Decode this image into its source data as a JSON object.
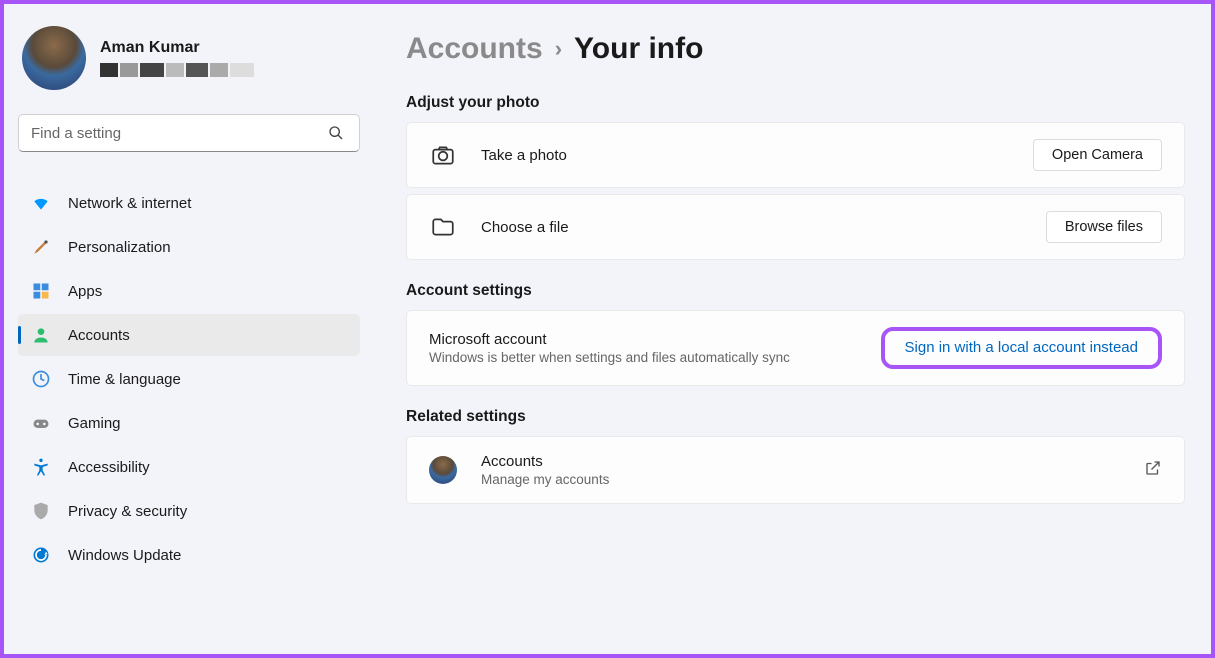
{
  "profile": {
    "name": "Aman Kumar"
  },
  "search": {
    "placeholder": "Find a setting"
  },
  "nav": {
    "network": "Network & internet",
    "personalization": "Personalization",
    "apps": "Apps",
    "accounts": "Accounts",
    "time": "Time & language",
    "gaming": "Gaming",
    "accessibility": "Accessibility",
    "privacy": "Privacy & security",
    "update": "Windows Update"
  },
  "breadcrumb": {
    "parent": "Accounts",
    "current": "Your info"
  },
  "sections": {
    "photo": {
      "title": "Adjust your photo",
      "take": "Take a photo",
      "take_btn": "Open Camera",
      "choose": "Choose a file",
      "choose_btn": "Browse files"
    },
    "account": {
      "title": "Account settings",
      "ms_title": "Microsoft account",
      "ms_sub": "Windows is better when settings and files automatically sync",
      "link": "Sign in with a local account instead"
    },
    "related": {
      "title": "Related settings",
      "acc_title": "Accounts",
      "acc_sub": "Manage my accounts"
    }
  }
}
